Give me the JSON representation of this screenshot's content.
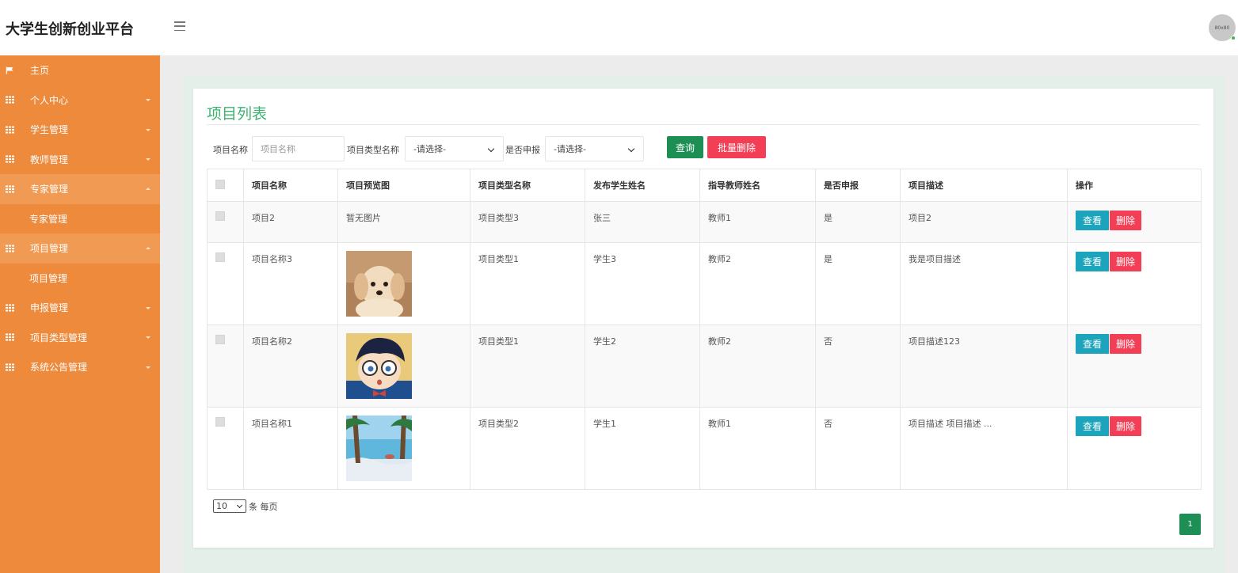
{
  "header": {
    "brand": "大学生创新创业平台",
    "avatar_text": "80x80"
  },
  "sidebar": {
    "items": [
      {
        "label": "主页",
        "icon": "flag-icon"
      },
      {
        "label": "个人中心",
        "icon": "grid-icon"
      },
      {
        "label": "学生管理",
        "icon": "grid-icon"
      },
      {
        "label": "教师管理",
        "icon": "grid-icon"
      },
      {
        "label": "专家管理",
        "icon": "grid-icon",
        "sub": "专家管理"
      },
      {
        "label": "项目管理",
        "icon": "grid-icon",
        "sub": "项目管理"
      },
      {
        "label": "申报管理",
        "icon": "grid-icon"
      },
      {
        "label": "项目类型管理",
        "icon": "grid-icon"
      },
      {
        "label": "系统公告管理",
        "icon": "grid-icon"
      }
    ]
  },
  "main": {
    "title": "项目列表",
    "search": {
      "name_label": "项目名称",
      "name_placeholder": "项目名称",
      "type_label": "项目类型名称",
      "type_value": "-请选择-",
      "declared_label": "是否申报",
      "declared_value": "-请选择-",
      "query_button": "查询",
      "batch_delete_button": "批量删除"
    },
    "table": {
      "headers": [
        "项目名称",
        "项目预览图",
        "项目类型名称",
        "发布学生姓名",
        "指导教师姓名",
        "是否申报",
        "项目描述",
        "操作"
      ],
      "rows": [
        {
          "name": "项目2",
          "preview": "暂无图片",
          "type": "项目类型3",
          "student": "张三",
          "teacher": "教师1",
          "declared": "是",
          "desc": "项目2"
        },
        {
          "name": "项目名称3",
          "preview": "",
          "type": "项目类型1",
          "student": "学生3",
          "teacher": "教师2",
          "declared": "是",
          "desc": "我是项目描述"
        },
        {
          "name": "项目名称2",
          "preview": "",
          "type": "项目类型1",
          "student": "学生2",
          "teacher": "教师2",
          "declared": "否",
          "desc": "项目描述123"
        },
        {
          "name": "项目名称1",
          "preview": "",
          "type": "项目类型2",
          "student": "学生1",
          "teacher": "教师1",
          "declared": "否",
          "desc": "项目描述 项目描述 ..."
        }
      ],
      "view_button": "查看",
      "delete_button": "删除"
    },
    "pager": {
      "page_size": "10",
      "per_page_text": "条 每页",
      "current_page": "1"
    }
  },
  "colors": {
    "sidebar": "#ee8a3c",
    "accent_green": "#1d8f55",
    "title_green": "#3cb371",
    "danger": "#f23f56",
    "info": "#1ba4bb"
  }
}
